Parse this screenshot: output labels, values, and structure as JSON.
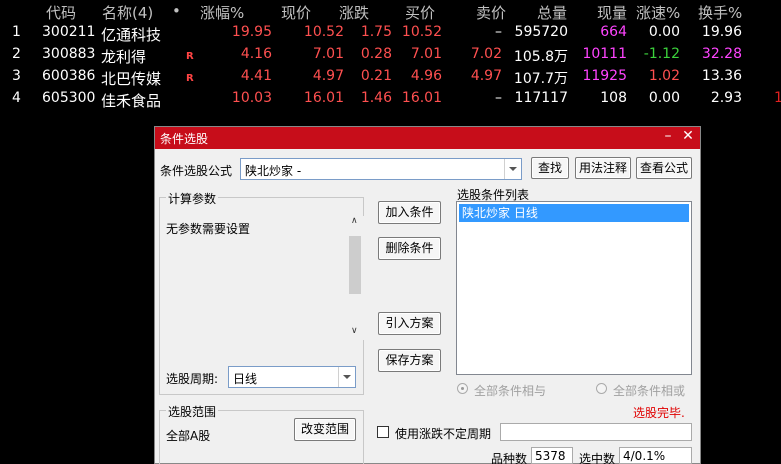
{
  "table": {
    "headers": {
      "code": "代码",
      "name": "名称(4)",
      "dot": "•",
      "pct": "涨幅%",
      "price": "现价",
      "change": "涨跌",
      "bid": "买价",
      "ask": "卖价",
      "volume": "总量",
      "cur": "现量",
      "speed": "涨速%",
      "turnover": "换手%"
    },
    "rows": [
      {
        "idx": "1",
        "code": "300211",
        "name": "亿通科技",
        "badge": "",
        "pct": "19.95",
        "price": "10.52",
        "change": "1.75",
        "bid": "10.52",
        "ask": "–",
        "volume": "595720",
        "cur": "664",
        "speed": "0.00",
        "turnover": "19.96",
        "extra": ""
      },
      {
        "idx": "2",
        "code": "300883",
        "name": "龙利得",
        "badge": "R",
        "pct": "4.16",
        "price": "7.01",
        "change": "0.28",
        "bid": "7.01",
        "ask": "7.02",
        "volume": "105.8万",
        "cur": "10111",
        "speed": "-1.12",
        "turnover": "32.28",
        "extra": ""
      },
      {
        "idx": "3",
        "code": "600386",
        "name": "北巴传媒",
        "badge": "R",
        "pct": "4.41",
        "price": "4.97",
        "change": "0.21",
        "bid": "4.96",
        "ask": "4.97",
        "volume": "107.7万",
        "cur": "11925",
        "speed": "1.02",
        "turnover": "13.36",
        "extra": ""
      },
      {
        "idx": "4",
        "code": "605300",
        "name": "佳禾食品",
        "badge": "",
        "pct": "10.03",
        "price": "16.01",
        "change": "1.46",
        "bid": "16.01",
        "ask": "–",
        "volume": "117117",
        "cur": "108",
        "speed": "0.00",
        "turnover": "2.93",
        "extra": "1"
      }
    ]
  },
  "dialog": {
    "title": "条件选股",
    "formula_label": "条件选股公式",
    "formula_value": "陕北炒家  -",
    "find_btn": "查找",
    "usage_btn": "用法注释",
    "view_btn": "查看公式",
    "calc_params_label": "计算参数",
    "no_params_text": "无参数需要设置",
    "period_label": "选股周期:",
    "period_value": "日线",
    "add_btn": "加入条件",
    "del_btn": "删除条件",
    "import_btn": "引入方案",
    "save_btn": "保存方案",
    "cond_list_label": "选股条件列表",
    "cond_items": [
      "陕北炒家  日线"
    ],
    "radio_and": "全部条件相与",
    "radio_or": "全部条件相或",
    "done_text": "选股完毕.",
    "range_label": "选股范围",
    "range_value": "全部A股",
    "change_range_btn": "改变范围",
    "use_period_label": "使用涨跌不定周期",
    "count_label": "品种数",
    "count_value": "5378",
    "hit_label": "选中数",
    "hit_value": "4/0.1%"
  }
}
